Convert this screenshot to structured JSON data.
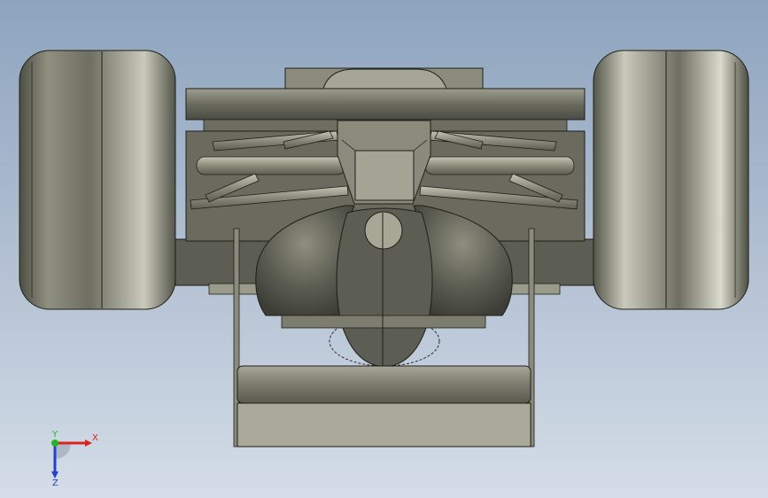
{
  "viewport": {
    "background_top": "#8ea4be",
    "background_bottom": "#d4dde8",
    "part_color": "#7c7d6f",
    "edge_color": "#1e1e1a"
  },
  "triad": {
    "x_label": "X",
    "y_label": "Y",
    "z_label": "Z",
    "x_color": "#d42424",
    "y_color": "#24b424",
    "z_color": "#2440d4"
  }
}
